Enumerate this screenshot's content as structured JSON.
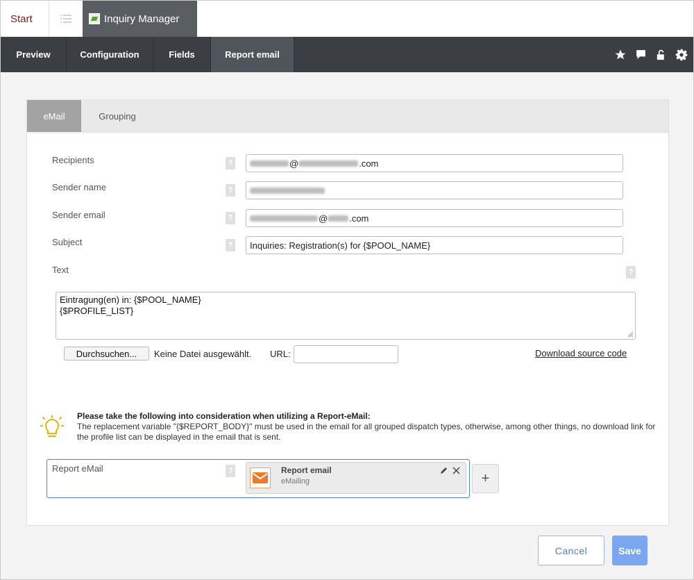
{
  "topbar": {
    "start_label": "Start",
    "app_title": "Inquiry Manager"
  },
  "nav": {
    "items": [
      {
        "label": "Preview"
      },
      {
        "label": "Configuration"
      },
      {
        "label": "Fields"
      },
      {
        "label": "Report email"
      }
    ],
    "active": "Report email",
    "icons": [
      "star-icon",
      "comment-icon",
      "unlock-icon",
      "gear-icon"
    ]
  },
  "tabs": {
    "email": "eMail",
    "grouping": "Grouping"
  },
  "form": {
    "recipients_label": "Recipients",
    "recipients_suffix": "@",
    "recipients_domain": ".com",
    "sender_name_label": "Sender name",
    "sender_email_label": "Sender email",
    "sender_email_suffix": "@",
    "sender_email_domain": ".com",
    "subject_label": "Subject",
    "subject_value": "Inquiries: Registration(s) for {$POOL_NAME}",
    "text_label": "Text",
    "text_line1": "Eintragung(en) in: {$POOL_NAME}",
    "text_line2": "{$PROFILE_LIST}",
    "help_glyph": "?"
  },
  "upload": {
    "browse_label": "Durchsuchen...",
    "no_file": "Keine Datei ausgewählt.",
    "url_label": "URL:",
    "download_link": "Download source code"
  },
  "hint": {
    "title": "Please take the following into consideration when utilizing a Report-eMail:",
    "body": "The replacement variable \"{$REPORT_BODY}\" must be used in the email for all grouped dispatch types, otherwise, among other things, no download link for the profile list can be displayed in the email that is sent."
  },
  "report": {
    "label": "Report eMail",
    "card_title": "Report email",
    "card_subtitle": "eMailing",
    "add_glyph": "+"
  },
  "actions": {
    "cancel": "Cancel",
    "save": "Save"
  },
  "colors": {
    "nav_bg": "#3b3f44",
    "accent_blue": "#4a7fe0",
    "save_bg": "#7aa7f0",
    "start_red": "#8b1a1a",
    "mail_orange": "#f07a28"
  }
}
